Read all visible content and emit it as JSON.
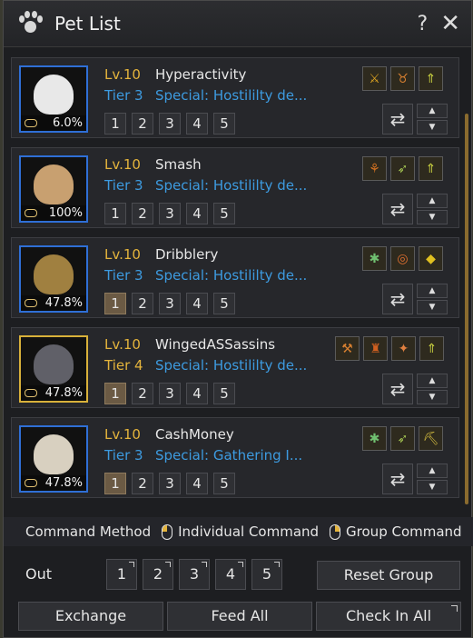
{
  "window": {
    "title": "Pet List",
    "help_label": "?",
    "close_label": "✕"
  },
  "pets": [
    {
      "level": "Lv.10",
      "name": "Hyperactivity",
      "tier": "Tier 3",
      "special": "Special: Hostililty de...",
      "hunger": "6.0%",
      "active_slot": 0,
      "skills": [
        "sword-icon",
        "horn-icon",
        "arrow-up-icon"
      ],
      "portrait_color": "#e8e8e8"
    },
    {
      "level": "Lv.10",
      "name": "Smash",
      "tier": "Tier 3",
      "special": "Special: Hostililty de...",
      "hunger": "100%",
      "active_slot": 0,
      "skills": [
        "wheat-icon",
        "wing-icon",
        "arrow-up-icon"
      ],
      "portrait_color": "#c8a070"
    },
    {
      "level": "Lv.10",
      "name": "Dribblery",
      "tier": "Tier 3",
      "special": "Special: Hostililty de...",
      "hunger": "47.8%",
      "active_slot": 1,
      "skills": [
        "paw-icon",
        "target-icon",
        "gem-icon"
      ],
      "portrait_color": "#a08040"
    },
    {
      "level": "Lv.10",
      "name": "WingedASSassins",
      "tier": "Tier 4",
      "special": "Special: Hostililty de...",
      "hunger": "47.8%",
      "active_slot": 1,
      "skills": [
        "hammer-icon",
        "bag-icon",
        "fox-icon",
        "arrow-up-icon"
      ],
      "portrait_color": "#606068"
    },
    {
      "level": "Lv.10",
      "name": "CashMoney",
      "tier": "Tier 3",
      "special": "Special: Gathering I...",
      "hunger": "47.8%",
      "active_slot": 1,
      "skills": [
        "paw-icon",
        "wing-icon",
        "pickaxe-icon"
      ],
      "portrait_color": "#d8d0c0"
    }
  ],
  "slot_labels": [
    "1",
    "2",
    "3",
    "4",
    "5"
  ],
  "command": {
    "method_label": "Command Method",
    "individual_label": "Individual Command",
    "group_label": "Group Command"
  },
  "out": {
    "label": "Out",
    "slots": [
      "1",
      "2",
      "3",
      "4",
      "5"
    ],
    "reset_label": "Reset Group"
  },
  "bottom": {
    "exchange_label": "Exchange",
    "feed_all_label": "Feed All",
    "check_in_all_label": "Check In All"
  },
  "colors": {
    "accent_gold": "#e4b43c",
    "accent_blue": "#3d9be0"
  }
}
